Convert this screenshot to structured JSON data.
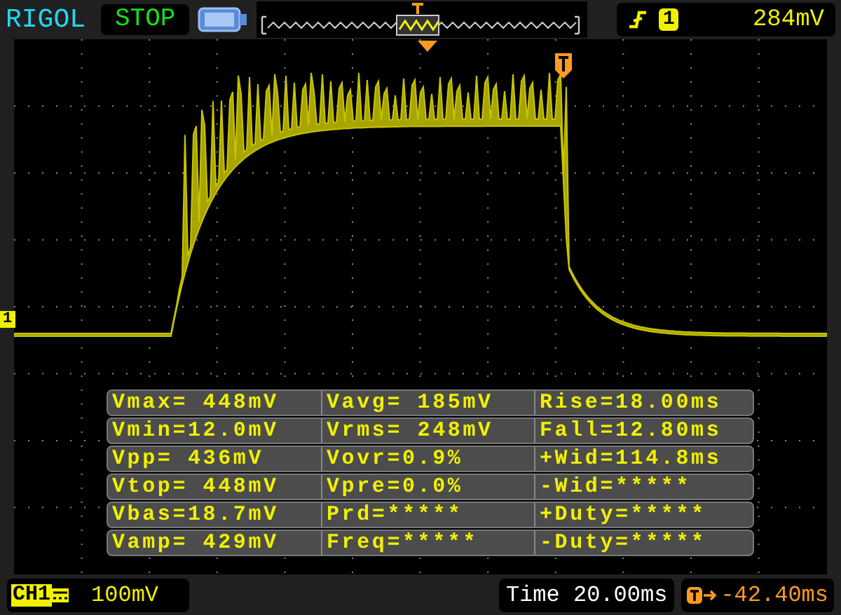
{
  "brand": "RIGOL",
  "run_state": "STOP",
  "trigger": {
    "source": "1",
    "trigger_level": "284mV"
  },
  "channel_marker": "1",
  "measurements": [
    [
      "Vmax= 448mV",
      "Vavg= 185mV",
      "Rise=18.00ms"
    ],
    [
      "Vmin=12.0mV",
      "Vrms= 248mV",
      "Fall=12.80ms"
    ],
    [
      "Vpp= 436mV",
      "Vovr=0.9%",
      "+Wid=114.8ms"
    ],
    [
      "Vtop= 448mV",
      "Vpre=0.0%",
      "-Wid=*****"
    ],
    [
      "Vbas=18.7mV",
      "Prd=*****",
      "+Duty=*****"
    ],
    [
      "Vamp= 429mV",
      "Freq=*****",
      "-Duty=*****"
    ]
  ],
  "channel": {
    "label": "CH1",
    "scale": "100mV"
  },
  "timebase": "Time 20.00ms",
  "trigger_offset": "-42.40ms"
}
